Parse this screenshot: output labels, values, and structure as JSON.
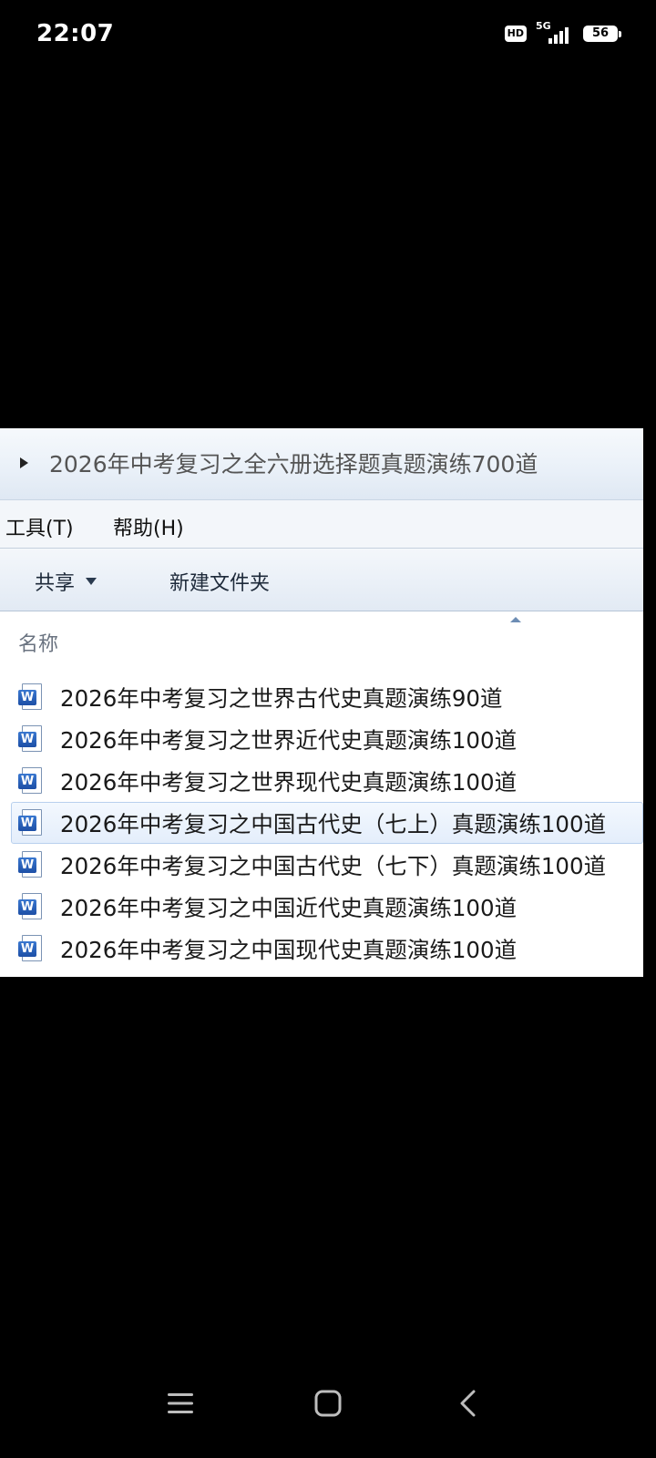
{
  "status_bar": {
    "time": "22:07",
    "hd_label": "HD",
    "network": "5G",
    "battery": "56"
  },
  "explorer": {
    "address": "2026年中考复习之全六册选择题真题演练700道",
    "menu": {
      "tools": "工具(T)",
      "help": "帮助(H)"
    },
    "toolbar": {
      "share": "共享",
      "new_folder": "新建文件夹"
    },
    "column_header": "名称",
    "files": [
      {
        "name": "2026年中考复习之世界古代史真题演练90道",
        "icon": "word-doc-icon",
        "selected": false
      },
      {
        "name": "2026年中考复习之世界近代史真题演练100道",
        "icon": "word-doc-icon",
        "selected": false
      },
      {
        "name": "2026年中考复习之世界现代史真题演练100道",
        "icon": "word-doc-icon",
        "selected": false
      },
      {
        "name": "2026年中考复习之中国古代史（七上）真题演练100道",
        "icon": "word-doc-icon",
        "selected": true
      },
      {
        "name": "2026年中考复习之中国古代史（七下）真题演练100道",
        "icon": "word-doc-icon",
        "selected": false
      },
      {
        "name": "2026年中考复习之中国近代史真题演练100道",
        "icon": "word-doc-icon",
        "selected": false
      },
      {
        "name": "2026年中考复习之中国现代史真题演练100道",
        "icon": "word-doc-icon",
        "selected": false
      }
    ],
    "word_icon_letter": "W"
  },
  "colors": {
    "selection_bg": "#e4eefb",
    "selection_border": "#b8d0ee",
    "word_blue": "#2b5fb8"
  }
}
